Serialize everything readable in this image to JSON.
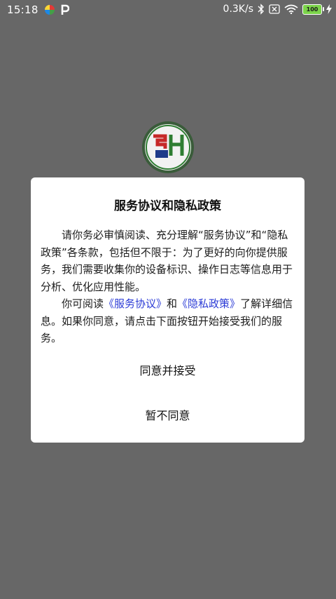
{
  "status_bar": {
    "time": "15:18",
    "net_speed": "0.3K/s",
    "battery_level": "100",
    "icons": [
      "pinwheel-app-icon",
      "p-app-icon",
      "bluetooth-icon",
      "sim-x-icon",
      "wifi-icon",
      "battery-icon",
      "charging-icon"
    ]
  },
  "app": {
    "logo_text": "SH",
    "colors": {
      "ring": "#2e7d32",
      "logo_red": "#c62828",
      "logo_green": "#2e7d32",
      "logo_blue": "#1e3a8a"
    }
  },
  "dialog": {
    "title": "服务协议和隐私政策",
    "paragraph1": "请你务必审慎阅读、充分理解“服务协议”和“隐私政策”各条款，包括但不限于：为了更好的向你提供服务，我们需要收集你的设备标识、操作日志等信息用于分析、优化应用性能。",
    "p2_prefix": "你可阅读",
    "service_link": "《服务协议》",
    "p2_and": "和",
    "privacy_link": "《隐私政策》",
    "p2_suffix": "了解详细信息。如果你同意，请点击下面按钮开始接受我们的服务。",
    "accept_label": "同意并接受",
    "decline_label": "暂不同意",
    "link_color": "#2b3bd6"
  }
}
